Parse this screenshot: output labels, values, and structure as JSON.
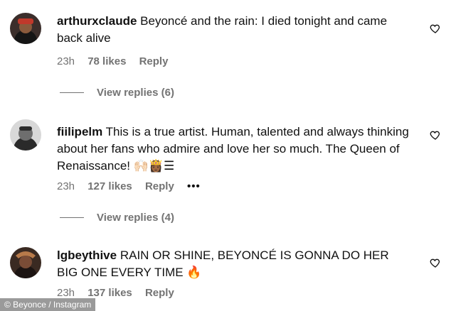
{
  "comments": [
    {
      "username": "arthurxclaude",
      "text": "Beyoncé and the rain: I died tonight and came back alive",
      "time": "23h",
      "likes": "78 likes",
      "reply": "Reply",
      "view_replies": "View replies (6)"
    },
    {
      "username": "fiilipelm",
      "text": "This is a true artist. Human, talented and always thinking about her fans who admire and love her so much. The Queen of Renaissance! 🙌🏻👸🏾☰",
      "time": "23h",
      "likes": "127 likes",
      "reply": "Reply",
      "more": "•••",
      "view_replies": "View replies (4)"
    },
    {
      "username": "lgbeythive",
      "text": "RAIN OR SHINE, BEYONCÉ IS GONNA DO HER BIG ONE EVERY TIME 🔥",
      "time": "23h",
      "likes": "137 likes",
      "reply": "Reply"
    }
  ],
  "credit": "© Beyonce / Instagram",
  "icons": {
    "like": "heart-outline-icon",
    "more": "more-dots-icon"
  }
}
